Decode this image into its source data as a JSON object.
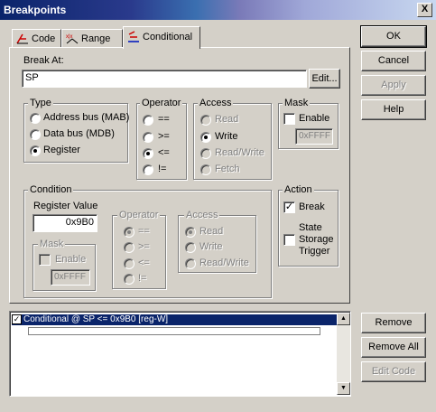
{
  "window": {
    "title": "Breakpoints",
    "close_glyph": "X"
  },
  "tabs": [
    {
      "label": "Code",
      "icon": "code-icon"
    },
    {
      "label": "Range",
      "icon": "range-icon"
    },
    {
      "label": "Conditional",
      "icon": "conditional-icon",
      "active": true
    }
  ],
  "break_at": {
    "label": "Break At:",
    "value": "SP",
    "edit_button": "Edit..."
  },
  "type": {
    "label": "Type",
    "options": [
      "Address bus (MAB)",
      "Data bus (MDB)",
      "Register"
    ],
    "selected": "Register"
  },
  "operator": {
    "label": "Operator",
    "options": [
      "==",
      ">=",
      "<=",
      "!="
    ],
    "selected": "<="
  },
  "access": {
    "label": "Access",
    "options": [
      "Read",
      "Write",
      "Read/Write",
      "Fetch"
    ],
    "selected": "Write"
  },
  "mask": {
    "label": "Mask",
    "enable_label": "Enable",
    "enabled": false,
    "value": "0xFFFF"
  },
  "condition": {
    "label": "Condition",
    "register_value_label": "Register Value",
    "register_value": "0x9B0",
    "mask": {
      "label": "Mask",
      "enable_label": "Enable",
      "value": "0xFFFF"
    },
    "operator": {
      "label": "Operator",
      "options": [
        "==",
        ">=",
        "<=",
        "!="
      ],
      "selected": "=="
    },
    "access": {
      "label": "Access",
      "options": [
        "Read",
        "Write",
        "Read/Write"
      ],
      "selected": "Read"
    }
  },
  "action": {
    "label": "Action",
    "break_label": "Break",
    "break_checked": true,
    "state_storage_label_1": "State",
    "state_storage_label_2": "Storage",
    "state_storage_label_3": "Trigger",
    "state_storage_checked": false
  },
  "buttons": {
    "ok": "OK",
    "cancel": "Cancel",
    "apply": "Apply",
    "help": "Help",
    "remove": "Remove",
    "remove_all": "Remove All",
    "edit_code": "Edit Code"
  },
  "breakpoint_list": [
    {
      "text": "Conditional @ SP <= 0x9B0 [reg-W]",
      "checked": true
    }
  ],
  "colors": {
    "face": "#d4d0c8",
    "selection": "#0a246a",
    "title_start": "#0a246a"
  }
}
